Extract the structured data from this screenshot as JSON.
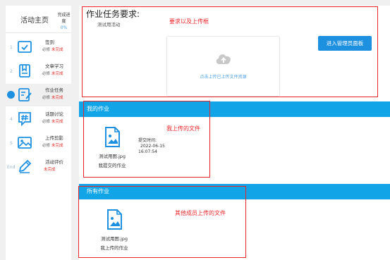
{
  "sidebar": {
    "title": "活动主页",
    "progress_label": "完成进度",
    "progress_value": "0%",
    "steps": [
      {
        "num": "1",
        "name": "签到",
        "req": "必修",
        "status": "未完成",
        "icon": "checkbox-icon"
      },
      {
        "num": "2",
        "name": "文章学习",
        "req": "必修",
        "status": "未完成",
        "icon": "bookmark-icon"
      },
      {
        "num": "",
        "name": "作业任务",
        "req": "必修",
        "status": "未完成",
        "icon": "edit-note-icon",
        "active": true
      },
      {
        "num": "4",
        "name": "话题讨论",
        "req": "必修",
        "status": "未完成",
        "icon": "hashtag-icon"
      },
      {
        "num": "5",
        "name": "上传剪影",
        "req": "必修",
        "status": "未完成",
        "icon": "image-icon"
      },
      {
        "num": "End",
        "name": "活动评价",
        "req": "",
        "status": "未完成",
        "icon": "pencil-icon"
      }
    ]
  },
  "task": {
    "title": "作业任务要求:",
    "description": "测试用活动",
    "admin_button": "进入管理员面板",
    "upload_hint": "点击上传已上传文件资源"
  },
  "my_work": {
    "header": "我的作业",
    "file_name": "测试用图.jpg",
    "owner_label": "我提交的作业",
    "submit_label": "提交时间:",
    "submit_date": "2022-06-15",
    "submit_time": "16:07:54"
  },
  "all_work": {
    "header": "所有作业",
    "file_name": "测试用图.jpg",
    "owner_label": "我上传的作业"
  },
  "annotations": {
    "requirement_upload": "要求以及上传框",
    "my_upload": "我上传的文件",
    "others_upload": "其他成员上传的文件"
  },
  "colors": {
    "accent": "#1e90e0",
    "section_bar": "#11a5e8",
    "annotation": "#e8262a",
    "incomplete": "#e0302a"
  }
}
